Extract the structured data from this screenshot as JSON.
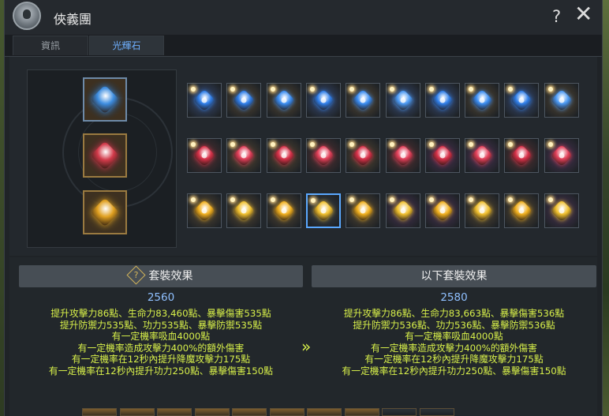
{
  "window": {
    "title": "俠義團",
    "help_label": "?",
    "close_label": "✕"
  },
  "tabs": [
    {
      "label": "資訊",
      "active": false
    },
    {
      "label": "光輝石",
      "active": true
    }
  ],
  "sockets": [
    {
      "icon": "blue-soulstone-icon",
      "color": "#3d8de0"
    },
    {
      "icon": "red-soulstone-icon",
      "color": "#d23a4a"
    },
    {
      "icon": "gold-soulstone-icon",
      "color": "#e0a020"
    }
  ],
  "inventory": {
    "rows": [
      {
        "color_name": "blue",
        "items": [
          {
            "gem": "#2f7ee8",
            "bg": "#3a4e78"
          },
          {
            "gem": "#2f7ee8",
            "bg": "#5a4a33"
          },
          {
            "gem": "#3a8cf0",
            "bg": "#5a4a33"
          },
          {
            "gem": "#2f7ee8",
            "bg": "#3a4e78"
          },
          {
            "gem": "#3a8cf0",
            "bg": "#5a4a33"
          },
          {
            "gem": "#4a98f2",
            "bg": "#3a4e78"
          },
          {
            "gem": "#2f7ee8",
            "bg": "#3a4e78"
          },
          {
            "gem": "#3a8cf0",
            "bg": "#5a4a33"
          },
          {
            "gem": "#2f7ee8",
            "bg": "#3a4e78"
          },
          {
            "gem": "#4a98f2",
            "bg": "#5a4a33"
          }
        ]
      },
      {
        "color_name": "red",
        "items": [
          {
            "gem": "#d8324a",
            "bg": "#5a3334"
          },
          {
            "gem": "#e2405a",
            "bg": "#5a4a33"
          },
          {
            "gem": "#d8324a",
            "bg": "#5a4a33"
          },
          {
            "gem": "#e2405a",
            "bg": "#5a3334"
          },
          {
            "gem": "#d8324a",
            "bg": "#5a4a33"
          },
          {
            "gem": "#e2405a",
            "bg": "#5a3334"
          },
          {
            "gem": "#d8324a",
            "bg": "#4e3458"
          },
          {
            "gem": "#e2405a",
            "bg": "#4e3458"
          },
          {
            "gem": "#d8324a",
            "bg": "#5a3334"
          },
          {
            "gem": "#e2405a",
            "bg": "#4e3458"
          }
        ]
      },
      {
        "color_name": "gold",
        "items": [
          {
            "gem": "#f0b020",
            "bg": "#5a4a33"
          },
          {
            "gem": "#f0c030",
            "bg": "#5a4a33"
          },
          {
            "gem": "#f0b020",
            "bg": "#5a4a33"
          },
          {
            "gem": "#f0c030",
            "bg": "#3a4048",
            "selected": true
          },
          {
            "gem": "#f0b020",
            "bg": "#5a4a33"
          },
          {
            "gem": "#f0c030",
            "bg": "#4e3458"
          },
          {
            "gem": "#f0b020",
            "bg": "#4e3458"
          },
          {
            "gem": "#f0c030",
            "bg": "#5a4a33"
          },
          {
            "gem": "#f0b020",
            "bg": "#5a4a33"
          },
          {
            "gem": "#f0c030",
            "bg": "#4e3458"
          }
        ]
      }
    ]
  },
  "set_effect": {
    "header": "套裝效果",
    "score": "2560",
    "lines": [
      "提升攻擊力86點、生命力83,460點、暴擊傷害535點",
      "提升防禦力535點、功力535點、暴擊防禦535點",
      "有一定機率吸血4000點",
      "有一定機率造成攻擊力400%的額外傷害",
      "有一定機率在12秒內提升降魔攻擊力175點",
      "有一定機率在12秒內提升功力250點、暴擊傷害150點"
    ]
  },
  "next_set_effect": {
    "header": "以下套裝效果",
    "score": "2580",
    "lines": [
      "提升攻擊力86點、生命力83,663點、暴擊傷害536點",
      "提升防禦力536點、功力536點、暴擊防禦536點",
      "有一定機率吸血4000點",
      "有一定機率造成攻擊力400%的額外傷害",
      "有一定機率在12秒內提升降魔攻擊力175點",
      "有一定機率在12秒內提升功力250點、暴擊傷害150點"
    ]
  },
  "arrow": "»",
  "colors": {
    "accent_blue": "#6fb0ff",
    "effect_text": "#d8f04a",
    "score_text": "#8fc0ff"
  }
}
